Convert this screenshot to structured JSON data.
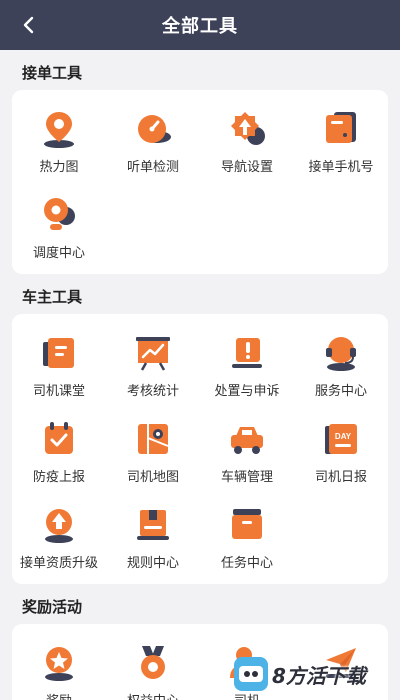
{
  "header": {
    "title": "全部工具",
    "back_icon": "back-arrow-icon"
  },
  "accent_color": "#f07a35",
  "sections": [
    {
      "title": "接单工具",
      "tools": [
        {
          "label": "热力图",
          "icon": "heatmap-pin-icon"
        },
        {
          "label": "听单检测",
          "icon": "gauge-icon"
        },
        {
          "label": "导航设置",
          "icon": "navigation-gear-icon"
        },
        {
          "label": "接单手机号",
          "icon": "phone-card-icon"
        },
        {
          "label": "调度中心",
          "icon": "dispatch-pin-icon"
        }
      ]
    },
    {
      "title": "车主工具",
      "tools": [
        {
          "label": "司机课堂",
          "icon": "classroom-book-icon"
        },
        {
          "label": "考核统计",
          "icon": "stats-board-icon"
        },
        {
          "label": "处置与申诉",
          "icon": "alert-flag-icon"
        },
        {
          "label": "服务中心",
          "icon": "headset-icon"
        },
        {
          "label": "防疫上报",
          "icon": "epidemic-check-icon"
        },
        {
          "label": "司机地图",
          "icon": "driver-map-icon"
        },
        {
          "label": "车辆管理",
          "icon": "car-icon"
        },
        {
          "label": "司机日报",
          "icon": "daily-calendar-icon"
        },
        {
          "label": "接单资质升级",
          "icon": "upgrade-badge-icon"
        },
        {
          "label": "规则中心",
          "icon": "rules-box-icon"
        },
        {
          "label": "任务中心",
          "icon": "task-folder-icon"
        }
      ]
    },
    {
      "title": "奖励活动",
      "tools": [
        {
          "label": "奖励",
          "icon": "reward-star-icon"
        },
        {
          "label": "权益中心",
          "icon": "medal-icon"
        },
        {
          "label": "司机",
          "icon": "driver-plus-icon"
        },
        {
          "label": "",
          "icon": "paper-plane-icon"
        }
      ]
    }
  ],
  "watermark": {
    "text": "8方活下载"
  }
}
